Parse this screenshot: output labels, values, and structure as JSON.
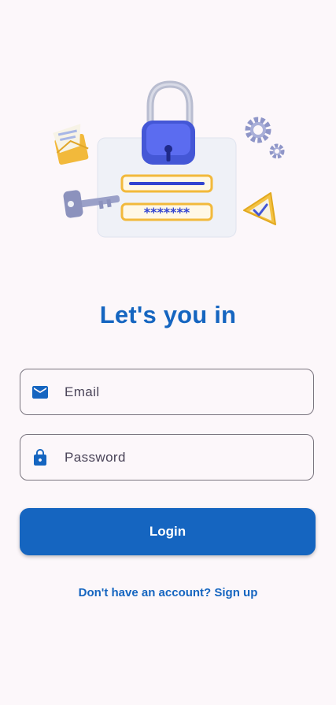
{
  "auth": {
    "title": "Let's you in",
    "email": {
      "placeholder": "Email",
      "icon": "mail-icon"
    },
    "password": {
      "placeholder": "Password",
      "icon": "lock-icon"
    },
    "login_label": "Login",
    "signup_prompt": "Don't have an account? Sign up"
  },
  "illustration": {
    "password_mask": "*******"
  },
  "colors": {
    "primary": "#1565c0",
    "background": "#fcf7fa",
    "field_border": "#79747e"
  }
}
